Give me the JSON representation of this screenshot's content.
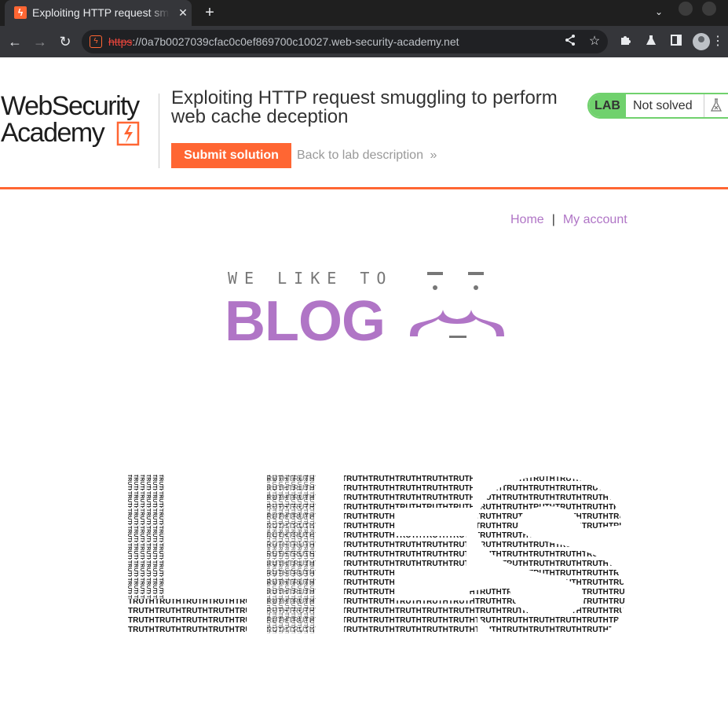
{
  "browser": {
    "tab_title": "Exploiting HTTP request smuggling to perform web cache deception",
    "tab_close": "✕",
    "new_tab": "+",
    "url_scheme": "https",
    "url_rest": "://0a7b0027039cfac0c0ef869700c10027.web-security-academy.net"
  },
  "academy": {
    "logo_line1": "WebSecurity",
    "logo_line2": "Academy",
    "lab_title": "Exploiting HTTP request smuggling to perform web cache deception",
    "submit_label": "Submit solution",
    "back_label": "Back to lab description",
    "lab_tag": "LAB",
    "lab_state": "Not solved",
    "colors": {
      "accent": "#ff6633",
      "solved_green": "#70d16d",
      "blog_purple": "#b075c6"
    }
  },
  "blog": {
    "nav": {
      "home": "Home",
      "separator": "|",
      "account": "My account"
    },
    "tagline": "WE LIKE TO",
    "logo_word": "BLOG",
    "hero_word": "LIES",
    "hero_fill_word": "TRUTH"
  }
}
